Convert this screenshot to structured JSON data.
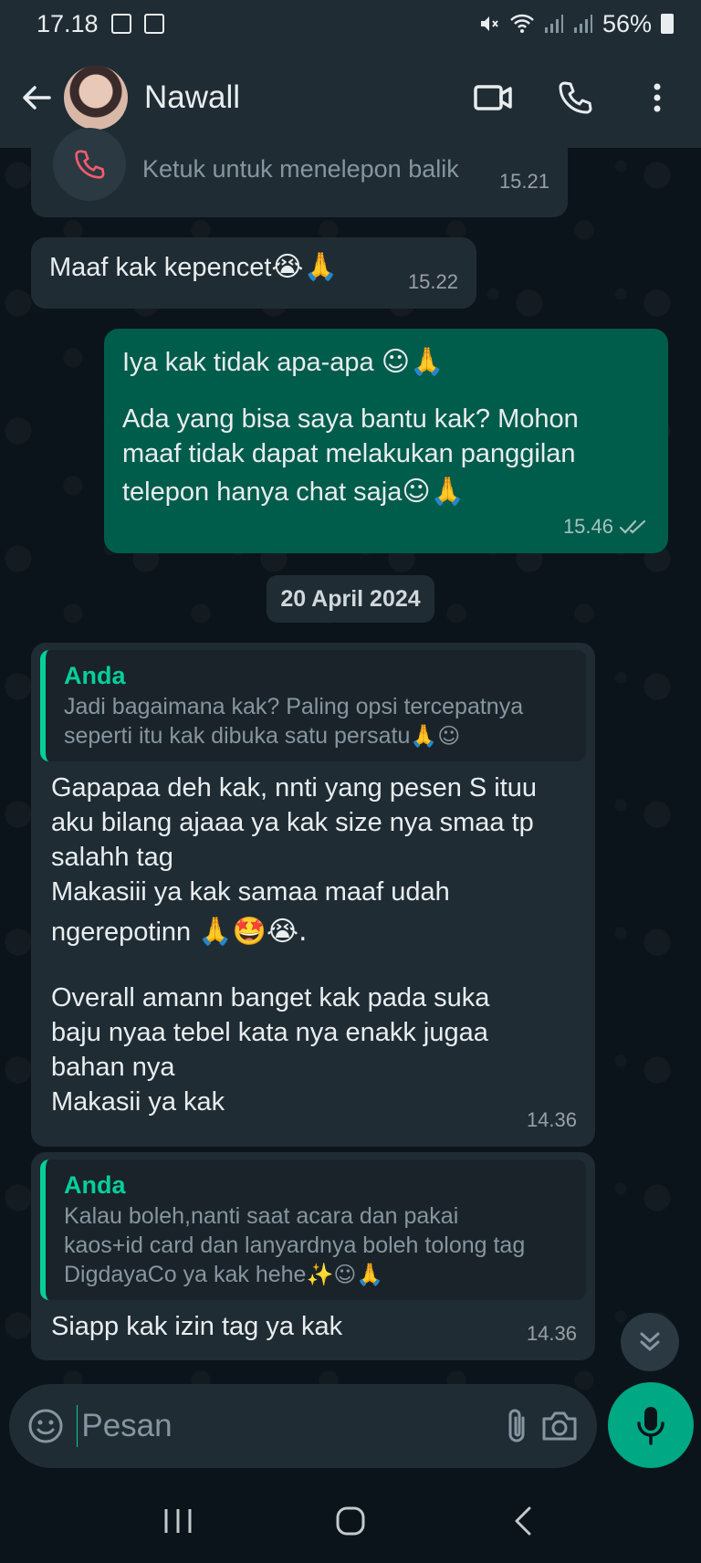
{
  "status_bar": {
    "time": "17.18",
    "battery": "56%"
  },
  "header": {
    "contact_name": "Nawall"
  },
  "missed_call": {
    "text": "Ketuk untuk menelepon balik",
    "time": "15.21"
  },
  "messages": [
    {
      "direction": "in",
      "text": "Maaf kak kepencet",
      "emoji": "😭🙏",
      "time": "15.22"
    },
    {
      "direction": "out",
      "line1": "Iya kak tidak apa-apa",
      "line1_emoji": "☺🙏",
      "line2": "Ada yang bisa saya bantu kak? Mohon",
      "line3": "maaf tidak dapat melakukan panggilan",
      "line4": "telepon hanya chat saja",
      "line4_emoji": "☺🙏",
      "time": "15.46",
      "status": "read"
    }
  ],
  "date_separator": "20 April 2024",
  "replies": [
    {
      "quote_author": "Anda",
      "quote_line1": "Jadi bagaimana kak? Paling opsi tercepatnya",
      "quote_line2": "seperti itu kak dibuka satu persatu",
      "quote_emoji": "🙏☺",
      "lines": [
        "Gapapaa deh kak, nnti yang pesen S ituu",
        "aku bilang ajaaa ya kak size nya smaa tp",
        "salahh tag",
        "Makasiii ya kak samaa maaf udah"
      ],
      "line5": "ngerepotinn",
      "line5_emoji": "🙏🤩😭.",
      "lines_b": [
        "Overall amann banget kak pada suka",
        "baju nyaa tebel kata nya enakk jugaa",
        "bahan nya",
        "Makasii ya kak"
      ],
      "time": "14.36"
    },
    {
      "quote_author": "Anda",
      "quote_line1": "Kalau boleh,nanti saat acara dan pakai",
      "quote_line2": "kaos+id card dan lanyardnya boleh tolong tag",
      "quote_line3": "DigdayaCo ya kak hehe",
      "quote_emoji": "✨☺🙏",
      "text": "Siapp kak izin tag ya kak",
      "time": "14.36"
    }
  ],
  "input": {
    "placeholder": "Pesan"
  },
  "colors": {
    "header_bg": "#1f2c34",
    "chat_bg": "#0b141a",
    "incoming_bubble": "#1f2c34",
    "outgoing_bubble": "#005c4b",
    "accent": "#00a884",
    "quote_author": "#06cf9c"
  },
  "icons": [
    "back-arrow-icon",
    "video-call-icon",
    "phone-icon",
    "more-vert-icon",
    "missed-call-icon",
    "double-check-icon",
    "emoji-icon",
    "attach-icon",
    "camera-icon",
    "mic-icon",
    "chevron-double-down-icon"
  ]
}
